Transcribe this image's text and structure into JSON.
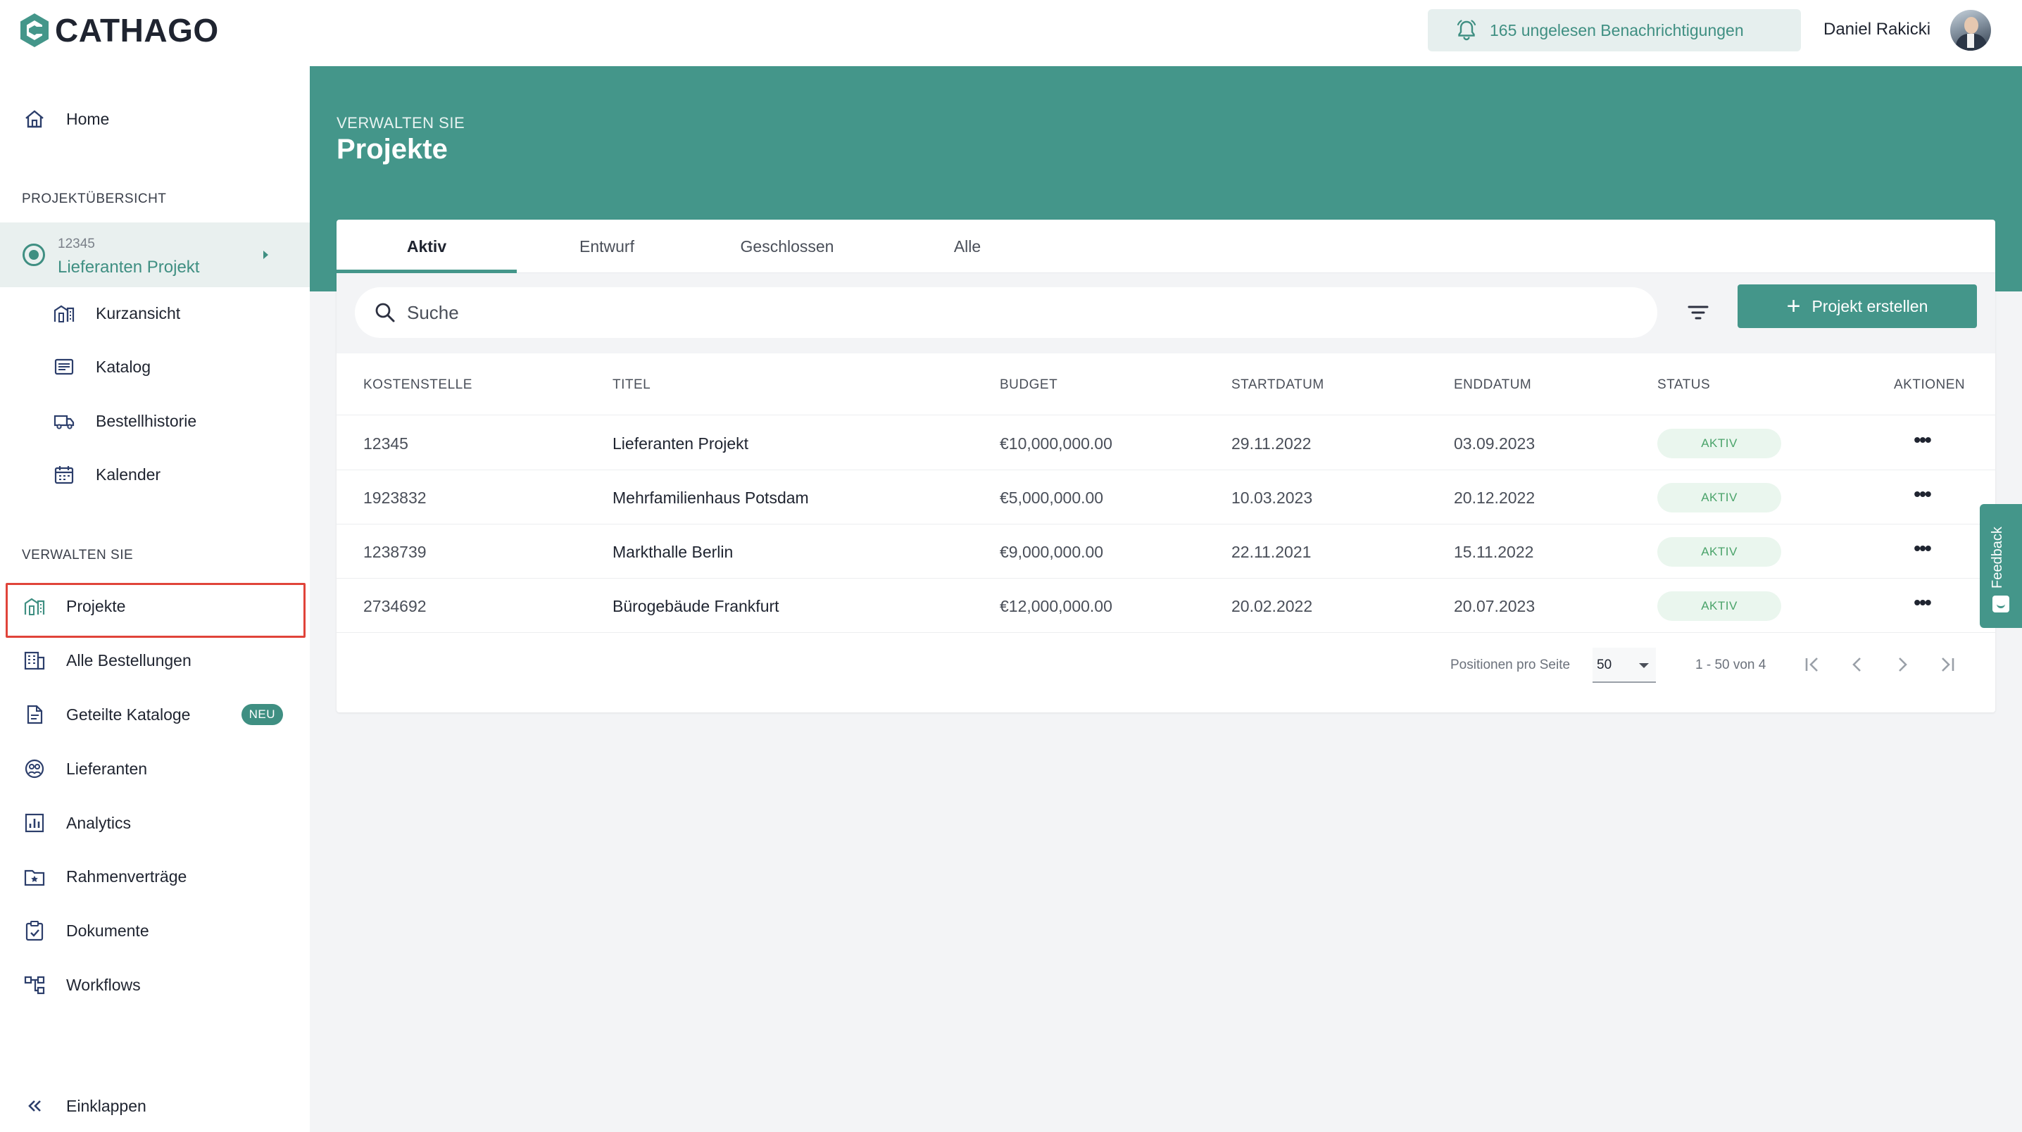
{
  "app": {
    "logo_text": "CATHAGO",
    "brand_color": "#44968a"
  },
  "header": {
    "notifications_label": "165 ungelesen Benachrichtigungen",
    "user_name": "Daniel Rakicki"
  },
  "sidebar": {
    "home_label": "Home",
    "project_overview_title": "PROJEKTÜBERSICHT",
    "selected_project": {
      "id": "12345",
      "name": "Lieferanten Projekt"
    },
    "project_items": [
      {
        "label": "Kurzansicht",
        "icon": "building-icon"
      },
      {
        "label": "Katalog",
        "icon": "catalog-icon"
      },
      {
        "label": "Bestellhistorie",
        "icon": "truck-icon"
      },
      {
        "label": "Kalender",
        "icon": "calendar-icon"
      }
    ],
    "manage_title": "VERWALTEN SIE",
    "manage_items": [
      {
        "label": "Projekte",
        "icon": "building-icon"
      },
      {
        "label": "Alle Bestellungen",
        "icon": "office-icon"
      },
      {
        "label": "Geteilte Kataloge",
        "icon": "document-icon",
        "badge": "NEU"
      },
      {
        "label": "Lieferanten",
        "icon": "supplier-icon"
      },
      {
        "label": "Analytics",
        "icon": "chart-icon"
      },
      {
        "label": "Rahmenverträge",
        "icon": "folder-star-icon"
      },
      {
        "label": "Dokumente",
        "icon": "clipboard-check-icon"
      },
      {
        "label": "Workflows",
        "icon": "workflow-icon"
      }
    ],
    "collapse_label": "Einklappen"
  },
  "page": {
    "eyebrow": "VERWALTEN SIE",
    "title": "Projekte"
  },
  "tabs": [
    "Aktiv",
    "Entwurf",
    "Geschlossen",
    "Alle"
  ],
  "toolbar": {
    "search_placeholder": "Suche",
    "create_label": "Projekt erstellen"
  },
  "table": {
    "columns": [
      "KOSTENSTELLE",
      "TITEL",
      "BUDGET",
      "STARTDATUM",
      "ENDDATUM",
      "STATUS",
      "AKTIONEN"
    ],
    "rows": [
      {
        "cost_center": "12345",
        "title": "Lieferanten Projekt",
        "budget": "€10,000,000.00",
        "start": "29.11.2022",
        "end": "03.09.2023",
        "status": "AKTIV"
      },
      {
        "cost_center": "1923832",
        "title": "Mehrfamilienhaus Potsdam",
        "budget": "€5,000,000.00",
        "start": "10.03.2023",
        "end": "20.12.2022",
        "status": "AKTIV"
      },
      {
        "cost_center": "1238739",
        "title": "Markthalle Berlin",
        "budget": "€9,000,000.00",
        "start": "22.11.2021",
        "end": "15.11.2022",
        "status": "AKTIV"
      },
      {
        "cost_center": "2734692",
        "title": "Bürogebäude Frankfurt",
        "budget": "€12,000,000.00",
        "start": "20.02.2022",
        "end": "20.07.2023",
        "status": "AKTIV"
      }
    ]
  },
  "pagination": {
    "per_page_label": "Positionen pro Seite",
    "per_page_value": "50",
    "range_label": "1 - 50 von 4"
  },
  "feedback_label": "Feedback"
}
